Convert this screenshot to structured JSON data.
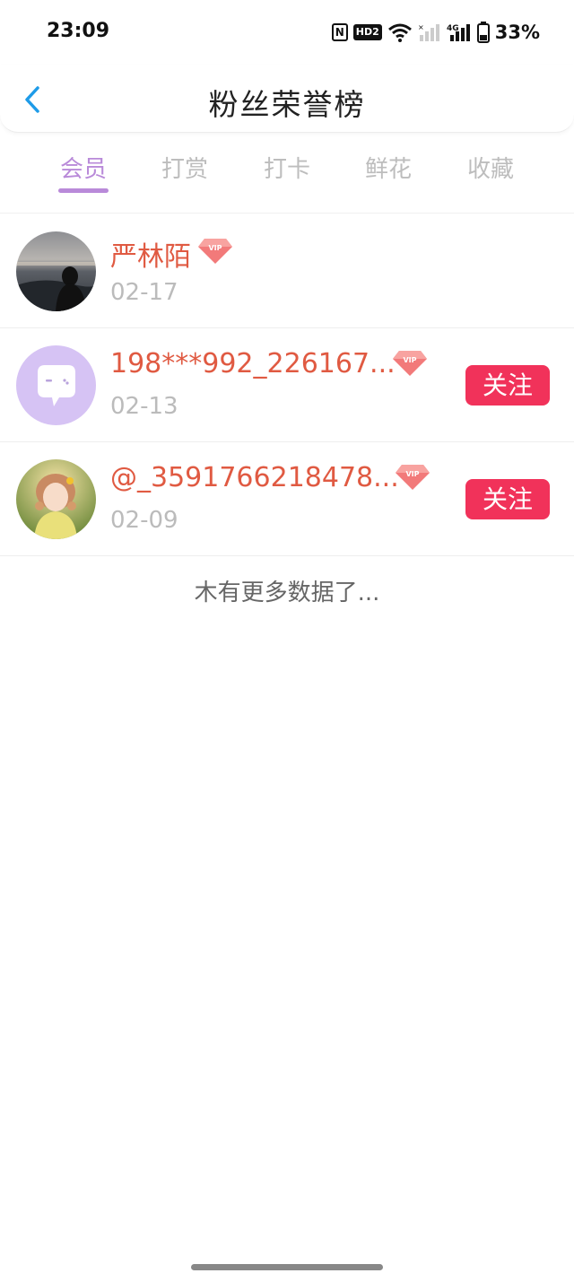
{
  "status_bar": {
    "time": "23:09",
    "hd_label": "HD2",
    "signal_label": "4G",
    "battery": "33%"
  },
  "header": {
    "title": "粉丝荣誉榜",
    "back_icon": "chevron-left-icon"
  },
  "tabs": [
    {
      "label": "会员",
      "active": true
    },
    {
      "label": "打赏",
      "active": false
    },
    {
      "label": "打卡",
      "active": false
    },
    {
      "label": "鲜花",
      "active": false
    },
    {
      "label": "收藏",
      "active": false
    }
  ],
  "fans": [
    {
      "name": "严林陌",
      "date": "02-17",
      "vip_label": "VIP",
      "follow_label": ""
    },
    {
      "name": "198***992_226167...",
      "date": "02-13",
      "vip_label": "VIP",
      "follow_label": "关注"
    },
    {
      "name": "@_3591766218478...",
      "date": "02-09",
      "vip_label": "VIP",
      "follow_label": "关注"
    }
  ],
  "footer_text": "木有更多数据了...",
  "colors": {
    "accent_purple": "#b98ad9",
    "name_red": "#e05a42",
    "follow_button": "#f1325a",
    "back_icon_blue": "#1e9be8"
  }
}
